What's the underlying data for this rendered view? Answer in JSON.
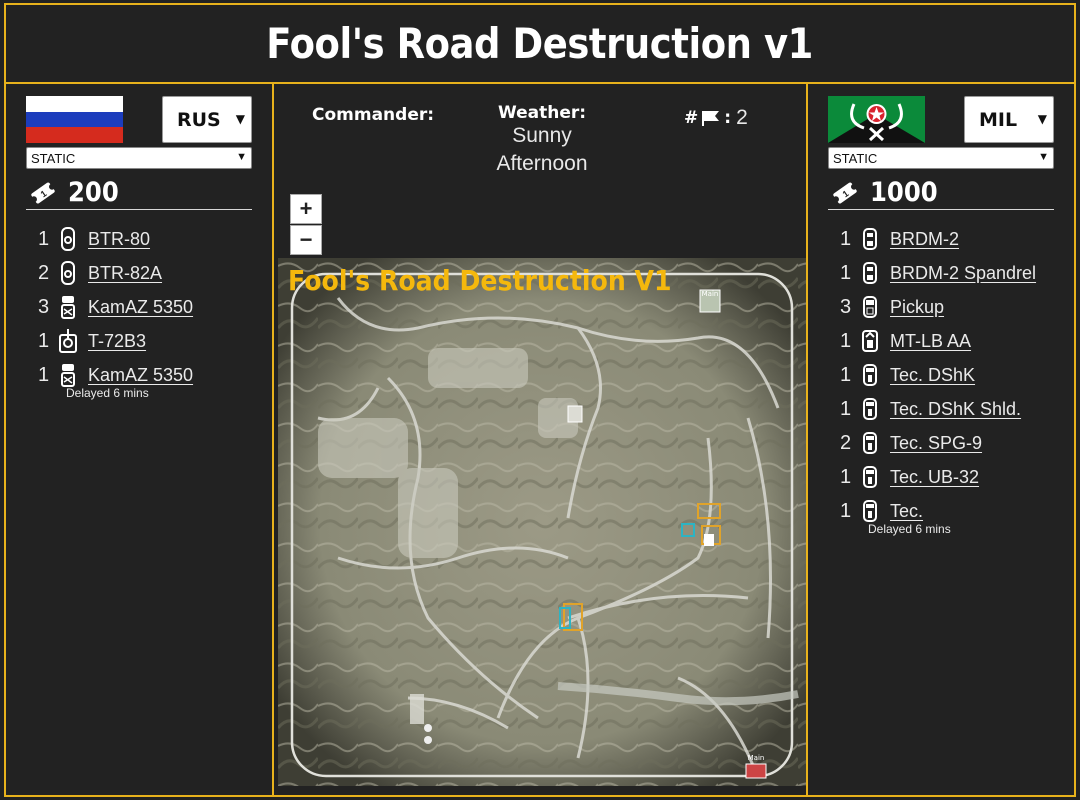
{
  "title": "Fool's Road Destruction v1",
  "colors": {
    "accent": "#e8b21c",
    "background": "#222222",
    "map_title": "#f5b80d"
  },
  "left": {
    "flag": "russia-flag",
    "country": "RUS",
    "mode": "STATIC",
    "points": "200",
    "units": [
      {
        "qty": "1",
        "icon": "btr-icon",
        "name": "BTR-80"
      },
      {
        "qty": "2",
        "icon": "btr-icon",
        "name": "BTR-82A"
      },
      {
        "qty": "3",
        "icon": "truck-icon",
        "name": "KamAZ 5350"
      },
      {
        "qty": "1",
        "icon": "tank-icon",
        "name": "T-72B3"
      },
      {
        "qty": "1",
        "icon": "truck-icon",
        "name": "KamAZ 5350",
        "note": "Delayed 6 mins"
      }
    ]
  },
  "right": {
    "flag": "militia-flag",
    "country": "MIL",
    "mode": "STATIC",
    "points": "1000",
    "units": [
      {
        "qty": "1",
        "icon": "car-icon",
        "name": "BRDM-2"
      },
      {
        "qty": "1",
        "icon": "car-icon",
        "name": "BRDM-2 Spandrel"
      },
      {
        "qty": "3",
        "icon": "pickup-icon",
        "name": "Pickup"
      },
      {
        "qty": "1",
        "icon": "aa-icon",
        "name": "MT-LB AA"
      },
      {
        "qty": "1",
        "icon": "technical-icon",
        "name": "Tec. DShK"
      },
      {
        "qty": "1",
        "icon": "technical-icon",
        "name": "Tec. DShK Shld."
      },
      {
        "qty": "2",
        "icon": "technical-icon",
        "name": "Tec. SPG-9"
      },
      {
        "qty": "1",
        "icon": "technical-icon",
        "name": "Tec. UB-32"
      },
      {
        "qty": "1",
        "icon": "technical-icon",
        "name": "Tec.",
        "note": "Delayed 6 mins"
      }
    ]
  },
  "center": {
    "commander_label": "Commander:",
    "weather_label": "Weather:",
    "weather_line1": "Sunny",
    "weather_line2": "Afternoon",
    "flags_label": "#",
    "flags_value": "2",
    "zoom_in": "+",
    "zoom_out": "−",
    "map_title": "Fool's Road Destruction V1",
    "main_label": "Main"
  }
}
